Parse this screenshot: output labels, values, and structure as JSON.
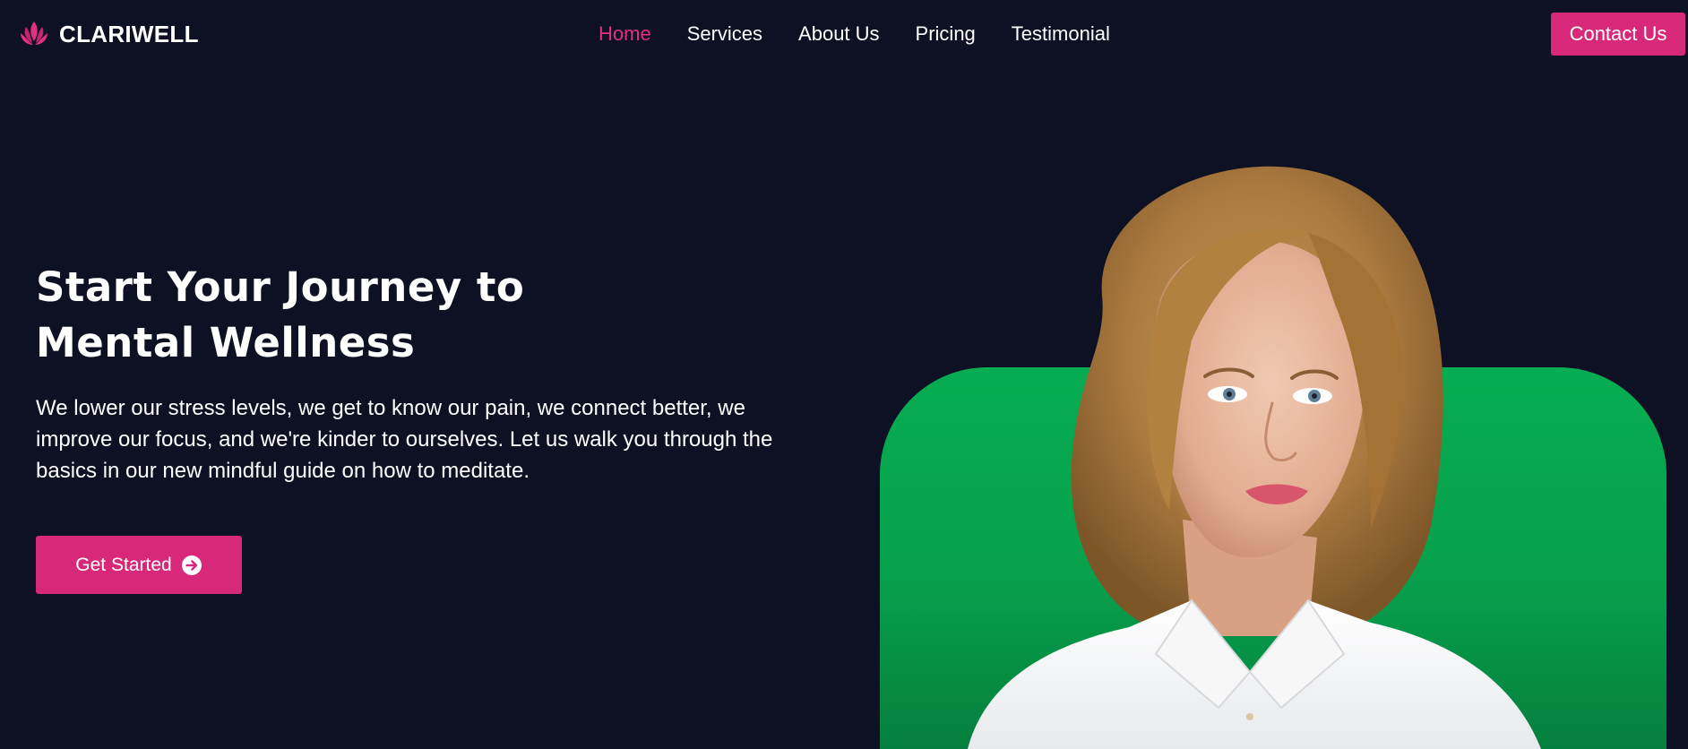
{
  "brand": {
    "name": "CLARIWELL",
    "logo_icon": "lotus-icon",
    "accent_color": "#d8287a"
  },
  "nav": {
    "items": [
      {
        "label": "Home",
        "active": true
      },
      {
        "label": "Services",
        "active": false
      },
      {
        "label": "About Us",
        "active": false
      },
      {
        "label": "Pricing",
        "active": false
      },
      {
        "label": "Testimonial",
        "active": false
      }
    ],
    "active_color": "#e0307f"
  },
  "header": {
    "contact_label": "Contact Us"
  },
  "hero": {
    "title_line1": "Start Your Journey to",
    "title_line2": "Mental Wellness",
    "description": "We lower our stress levels, we get to know our pain, we connect better, we improve our focus, and we're kinder to ourselves. Let us walk you through the basics in our new mindful guide on how to meditate.",
    "cta_label": "Get Started",
    "cta_icon": "arrow-right-circle-icon"
  },
  "colors": {
    "background": "#0e1124",
    "panel_green": "#07a04c",
    "button": "#d8287a"
  }
}
